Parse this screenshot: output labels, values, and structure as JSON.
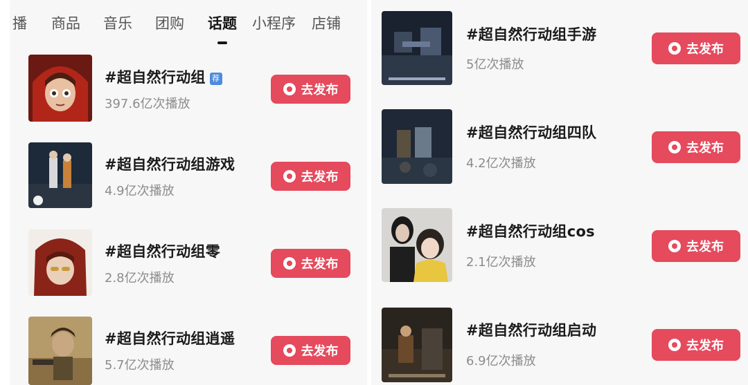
{
  "tabs": [
    "播",
    "商品",
    "音乐",
    "团购",
    "话题",
    "小程序",
    "店铺"
  ],
  "active_tab": "话题",
  "publish_label": "去发布",
  "rec_badge": "荐",
  "left_topics": [
    {
      "title": "#超自然行动组",
      "plays": "397.6亿次播放",
      "thumb_icon": "red-hood-character-thumbnail"
    },
    {
      "title": "#超自然行动组游戏",
      "plays": "4.9亿次播放",
      "thumb_icon": "game-scene-thumbnail"
    },
    {
      "title": "#超自然行动组零",
      "plays": "2.8亿次播放",
      "thumb_icon": "character-portrait-thumbnail"
    },
    {
      "title": "#超自然行动组逍遥",
      "plays": "5.7亿次播放",
      "thumb_icon": "character-portrait-thumbnail"
    }
  ],
  "right_topics": [
    {
      "title": "#超自然行动组手游",
      "plays": "5亿次播放",
      "thumb_icon": "game-scene-thumbnail"
    },
    {
      "title": "#超自然行动组四队",
      "plays": "4.2亿次播放",
      "thumb_icon": "game-scene-thumbnail"
    },
    {
      "title": "#超自然行动组cos",
      "plays": "2.1亿次播放",
      "thumb_icon": "cosplay-photo-thumbnail"
    },
    {
      "title": "#超自然行动组启动",
      "plays": "6.9亿次播放",
      "thumb_icon": "game-scene-thumbnail"
    }
  ],
  "colors": {
    "accent": "#e54a5d",
    "badge": "#4f8bdc"
  }
}
